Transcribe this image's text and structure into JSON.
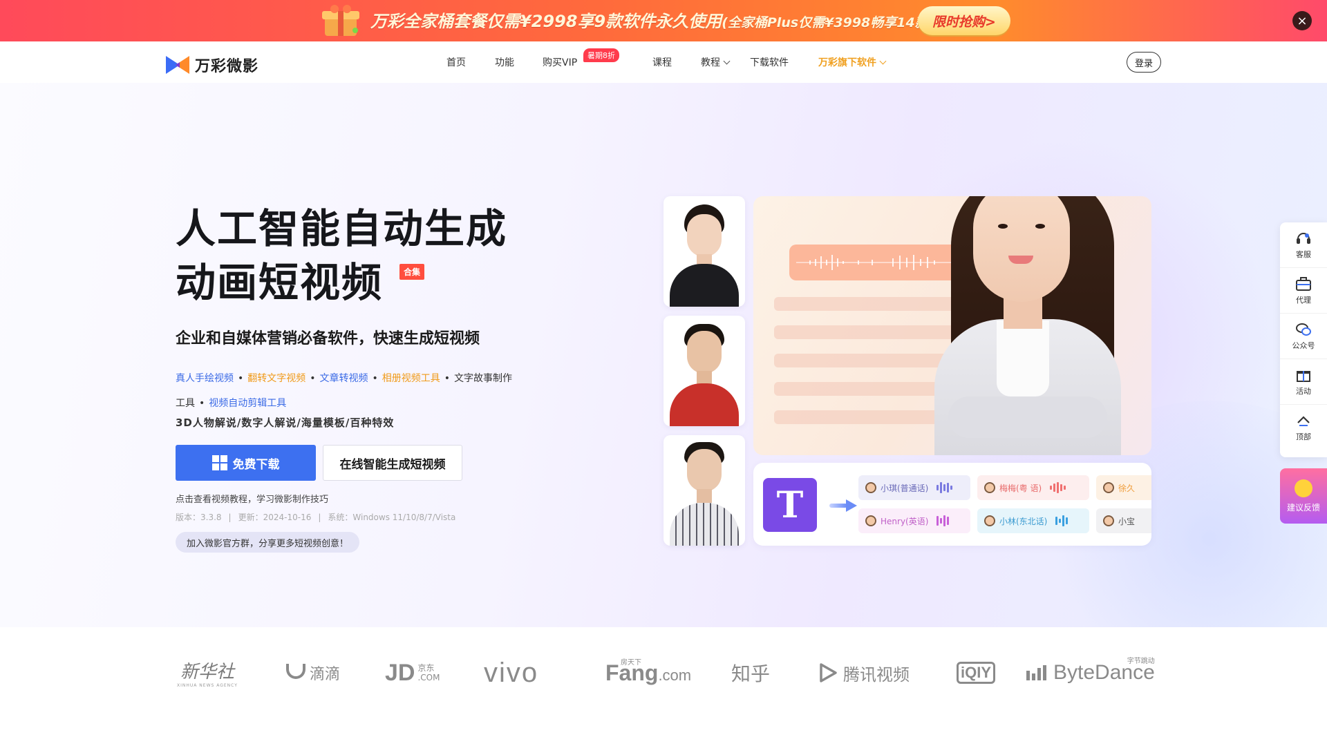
{
  "promo": {
    "text_main": "万彩全家桶套餐仅需¥2998享9款软件永久使用",
    "text_small": "(全家桶Plus仅需¥3998畅享14款产品)",
    "button": "限时抢购>",
    "close": "×"
  },
  "nav": {
    "logo": "万彩微影",
    "items": [
      "首页",
      "功能",
      "购买VIP",
      "课程",
      "教程",
      "下载软件",
      "万彩旗下软件"
    ],
    "vip_badge": "暑期8折",
    "login": "登录"
  },
  "hero": {
    "title_line1": "人工智能自动生成",
    "title_line2": "动画短视频",
    "title_badge": "合集",
    "subtitle": "企业和自媒体营销必备软件，快速生成短视频",
    "features": [
      "真人手绘视频",
      "翻转文字视频",
      "文章转视频",
      "相册视频工具",
      "文字故事制作",
      "工具",
      "视频自动剪辑工具"
    ],
    "feature_line2": "3D人物解说/数字人解说/海量模板/百种特效",
    "download_button": "免费下载",
    "online_button": "在线智能生成短视频",
    "tutorial_link": "点击查看视频教程，学习微影制作技巧",
    "version": "版本：3.3.8",
    "update": "更新：2024-10-16",
    "system": "系统：Windows 11/10/8/7/Vista",
    "group": "加入微影官方群，分享更多短视频创意！"
  },
  "voice_card": {
    "t_icon": "T",
    "voices_row1": [
      "小琪(普通话)",
      "梅梅(粤 语)",
      "徐久"
    ],
    "voices_row2": [
      "Henry(英语)",
      "小林(东北话)",
      "小宝"
    ]
  },
  "side_toolbar": {
    "items": [
      "客服",
      "代理",
      "公众号",
      "活动",
      "顶部"
    ],
    "feedback": "建议反馈"
  },
  "partners": {
    "xinhua_cn": "新华社",
    "xinhua_en": "XINHUA NEWS AGENCY",
    "didi": "滴滴",
    "jd": "JD",
    "jd_cn": "京东",
    "jd_com": ".COM",
    "vivo": "vivo",
    "fang": "Fang",
    "fang_com": ".com",
    "fang_cn": "房天下",
    "zhihu": "知乎",
    "tencent": "腾讯视频",
    "iqiyi": "iQIY",
    "bytedance": "ByteDance",
    "bytedance_cn": "字节跳动"
  }
}
